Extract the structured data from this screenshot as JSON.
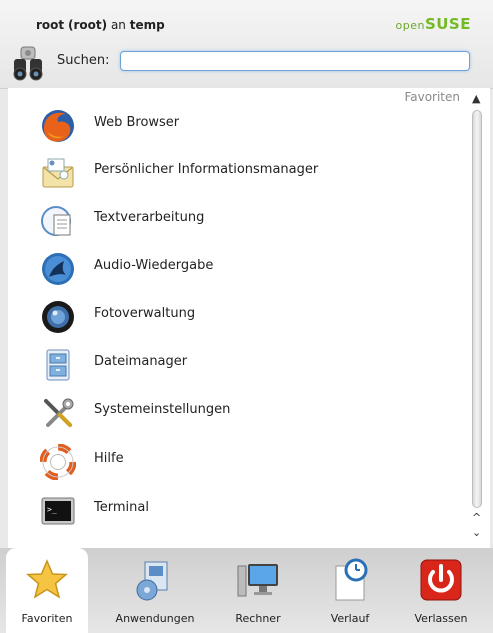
{
  "header": {
    "user_name": "root",
    "user_login": "(root)",
    "user_connector": "an",
    "host": "temp",
    "brand_light": "open",
    "brand_bold": "SUSE",
    "search_label": "Suchen:",
    "search_value": ""
  },
  "section_label": "Favoriten",
  "items": [
    {
      "label": "Web Browser",
      "icon": "firefox-icon"
    },
    {
      "label": "Persönlicher Informationsmanager",
      "icon": "kontact-icon"
    },
    {
      "label": "Textverarbeitung",
      "icon": "word-processor-icon"
    },
    {
      "label": "Audio-Wiedergabe",
      "icon": "amarok-icon"
    },
    {
      "label": "Fotoverwaltung",
      "icon": "digikam-icon"
    },
    {
      "label": "Dateimanager",
      "icon": "file-manager-icon"
    },
    {
      "label": "Systemeinstellungen",
      "icon": "tools-icon"
    },
    {
      "label": "Hilfe",
      "icon": "lifebuoy-icon"
    },
    {
      "label": "Terminal",
      "icon": "terminal-icon"
    }
  ],
  "tabs": [
    {
      "label": "Favoriten",
      "icon": "star-icon",
      "active": true
    },
    {
      "label": "Anwendungen",
      "icon": "applications-icon",
      "active": false
    },
    {
      "label": "Rechner",
      "icon": "computer-icon",
      "active": false
    },
    {
      "label": "Verlauf",
      "icon": "history-icon",
      "active": false
    },
    {
      "label": "Verlassen",
      "icon": "power-icon",
      "active": false
    }
  ],
  "colors": {
    "brand": "#73ba25",
    "search_border": "#6ea3d8",
    "power_red": "#d8261b"
  }
}
